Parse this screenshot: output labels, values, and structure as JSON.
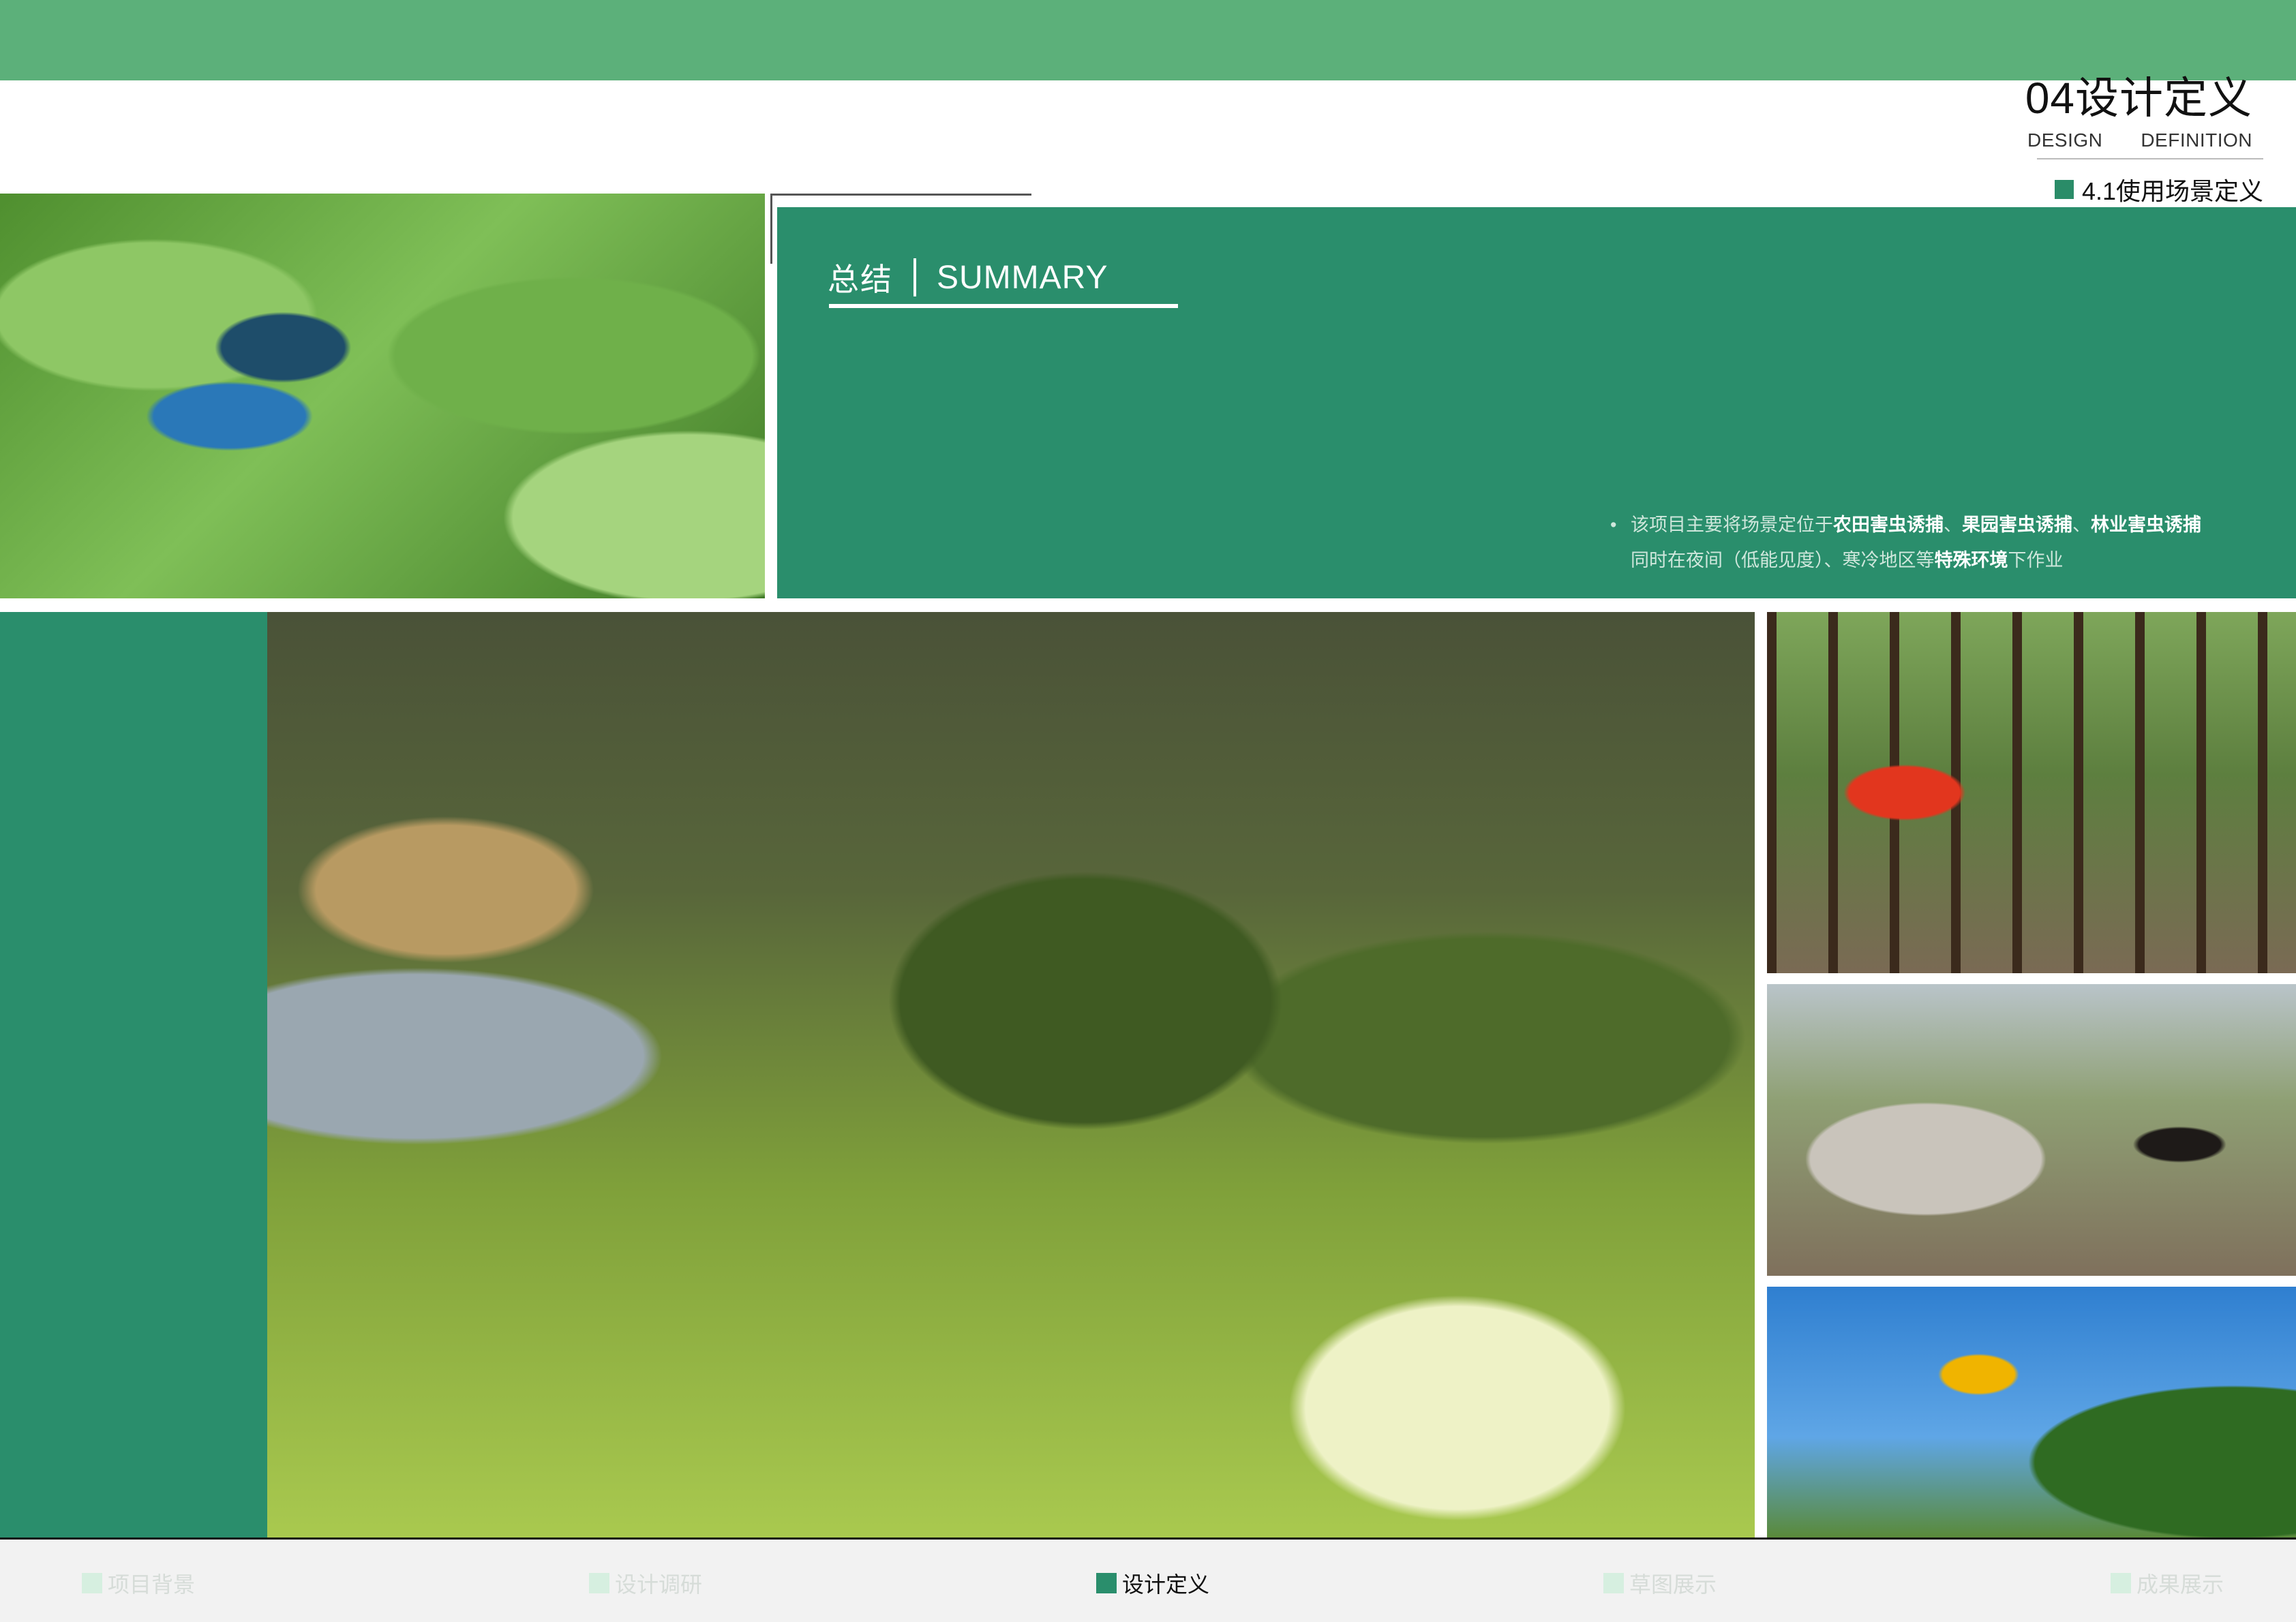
{
  "header": {
    "section_number_title": "04设计定义",
    "sub_en_left": "DESIGN",
    "sub_en_right": "DEFINITION",
    "subsection": "4.1使用场景定义"
  },
  "summary": {
    "title_cn": "总结",
    "title_en": "SUMMARY",
    "line1_prefix": "该项目主要将场景定位于",
    "line1_term1": "农田害虫诱捕",
    "sep1": "、",
    "line1_term2": "果园害虫诱捕",
    "sep2": "、",
    "line1_term3": "林业害虫诱捕",
    "line2_prefix": "同时在夜间（低能见度）、寒冷地区等",
    "line2_term": "特殊环境",
    "line2_suffix": "下作业"
  },
  "nav": {
    "items": [
      {
        "label": "项目背景",
        "active": false
      },
      {
        "label": "设计调研",
        "active": false
      },
      {
        "label": "设计定义",
        "active": true
      },
      {
        "label": "草图展示",
        "active": false
      },
      {
        "label": "成果展示",
        "active": false
      }
    ]
  },
  "colors": {
    "top_band": "#5cb07a",
    "panel_green": "#2a8e6c",
    "nav_inactive": "#d6dcd8"
  }
}
